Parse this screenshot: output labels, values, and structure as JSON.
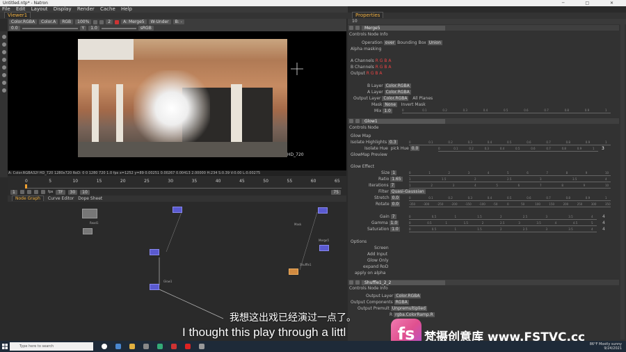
{
  "window": {
    "title": "Untitled.ntp* - Natron",
    "controls": "─ □ ✕"
  },
  "menu": [
    "File",
    "Edit",
    "Layout",
    "Display",
    "Render",
    "Cache",
    "Help"
  ],
  "viewer": {
    "tab": "Viewer1",
    "bar1": [
      "Color.RGBA",
      "Color.A",
      "RGB",
      "100%",
      "2",
      "A: Merge5",
      "W-Under",
      "B: -"
    ],
    "bar2": [
      "0.0",
      "Y",
      "1.0",
      "sRGB"
    ],
    "info": "A: Color.RGBA32f     HD_720 1280x720     RoD: 0 0 1280 720     1.0 fps     x=1252 y=89     0.00251 0.00267 0.00413 2.00000     H:234 S:0.39 V:0.00 L:0.00275",
    "frame_label": "HD_720"
  },
  "timeline": {
    "ticks": [
      "0",
      "5",
      "10",
      "15",
      "20",
      "25",
      "30",
      "35",
      "40",
      "45",
      "50",
      "55",
      "60",
      "65"
    ],
    "current": "0",
    "fps_label": "fps",
    "tf_label": "TF",
    "fps_value": "30",
    "step_value": "10",
    "end_value": "75",
    "start_value": "1"
  },
  "nodegraph": {
    "tabs": [
      "Node Graph",
      "Curve Editor",
      "Dope Sheet"
    ],
    "labels": [
      "Read1",
      "Merge5",
      "Mask",
      "Glow1",
      "Shuffle1"
    ]
  },
  "properties": {
    "tab": "Properties",
    "count": "10",
    "merge": {
      "name": "Merge5",
      "tabs": "Controls  Node  Info",
      "operation_label": "Operation",
      "operation": "over",
      "bbox_label": "Bounding Box",
      "bbox": "Union",
      "alpha_masking": "Alpha masking",
      "a_channels": "A Channels",
      "b_channels": "B Channels",
      "output": "Output",
      "rgba": "R G B A",
      "b_layer_label": "B Layer",
      "b_layer": "Color.RGBA",
      "a_layer_label": "A Layer",
      "a_layer": "Color.RGBA",
      "output_layer_label": "Output Layer",
      "output_layer": "Color.RGBA",
      "all_planes": "All Planes",
      "mask_label": "Mask",
      "mask": "None",
      "invert_mask": "Invert Mask",
      "mix_label": "Mix",
      "mix": "1.0",
      "mix_ticks": [
        "0",
        "0.1",
        "0.2",
        "0.3",
        "0.4",
        "0.5",
        "0.6",
        "0.7",
        "0.8",
        "0.9",
        "1"
      ]
    },
    "glow": {
      "name": "Glow1",
      "tabs": "Controls  Node",
      "glowmap": "Glow Map",
      "isolate_label": "Isolate Highlights",
      "isolate": "0.3",
      "isolate_ticks": [
        "0",
        "0.1",
        "0.2",
        "0.3",
        "0.4",
        "0.5",
        "0.6",
        "0.7",
        "0.8",
        "0.9",
        "1"
      ],
      "hue_label": "Isolate Hue",
      "pick_hue_label": "pick Hue",
      "pick_hue": "0.0",
      "hue_ticks": [
        "0",
        "0.1",
        "0.2",
        "0.3",
        "0.4",
        "0.5",
        "0.6",
        "0.7",
        "0.8",
        "0.9",
        "1"
      ],
      "hue_value": "3",
      "preview": "GlowMap Preview",
      "glow_effect": "Glow Effect",
      "size_label": "Size",
      "size": "1",
      "size_ticks": [
        "0",
        "1",
        "2",
        "3",
        "4",
        "5",
        "6",
        "7",
        "8",
        "9",
        "10"
      ],
      "ratio_label": "Ratio",
      "ratio": "1.65",
      "ratio_ticks": [
        "1",
        "1.5",
        "2",
        "2.5",
        "3",
        "3.5",
        "4"
      ],
      "iter_label": "Iterations",
      "iter": "7",
      "iter_ticks": [
        "1",
        "2",
        "3",
        "4",
        "5",
        "6",
        "7",
        "8",
        "9",
        "10"
      ],
      "filter_label": "Filter",
      "filter": "Quasi-Gaussian",
      "stretch_label": "Stretch",
      "stretch": "0.0",
      "stretch_ticks": [
        "0",
        "0.1",
        "0.2",
        "0.3",
        "0.4",
        "0.5",
        "0.6",
        "0.7",
        "0.8",
        "0.9",
        "1"
      ],
      "rotate_label": "Rotate",
      "rotate": "0.0",
      "rotate_ticks": [
        "-350",
        "-300",
        "-250",
        "-200",
        "-150",
        "-100",
        "-50",
        "0",
        "50",
        "100",
        "150",
        "200",
        "250",
        "300",
        "350"
      ],
      "gain_label": "Gain",
      "gain": "7",
      "gain_ticks": [
        "0",
        "0.5",
        "1",
        "1.5",
        "2",
        "2.5",
        "3",
        "3.5",
        "4"
      ],
      "gamma_label": "Gamma",
      "gamma": "1.0",
      "gamma_ticks": [
        "0",
        "0.5",
        "1",
        "1.5",
        "2",
        "2.5",
        "3",
        "3.5",
        "4",
        "4.5",
        "5"
      ],
      "sat_label": "Saturation",
      "sat": "1.0",
      "sat_ticks": [
        "0",
        "0.5",
        "1",
        "1.5",
        "2",
        "2.5",
        "3",
        "3.5",
        "4"
      ],
      "side_values": [
        "4",
        "4",
        "4"
      ],
      "options": "Options",
      "screen": "Screen",
      "add_input": "Add Input",
      "glow_only": "Glow Only",
      "expand_rod": "expand RoD",
      "apply_alpha": "apply on alpha"
    },
    "shuffle": {
      "name": "Shuffle1_2_2",
      "tabs": "Controls  Node  Info",
      "output_layer_label": "Output Layer",
      "output_layer": "Color.RGBA",
      "output_comp_label": "Output Components",
      "output_comp": "RGBA",
      "premult_label": "Output Premult",
      "premult": "Unpremultiplied",
      "r_label": "R",
      "r": "rgba.ColorRamp.R"
    }
  },
  "subtitles": {
    "cn": "我想这出戏已经演过一点了。",
    "en": "I thought this play through a littl"
  },
  "brand": {
    "logo": "fs",
    "text": "梵摄创意库 www.FSTVC.cc"
  },
  "taskbar": {
    "search": "Type here to search",
    "weather": "86°F  Mostly sunny",
    "date": "9/24/2021"
  }
}
